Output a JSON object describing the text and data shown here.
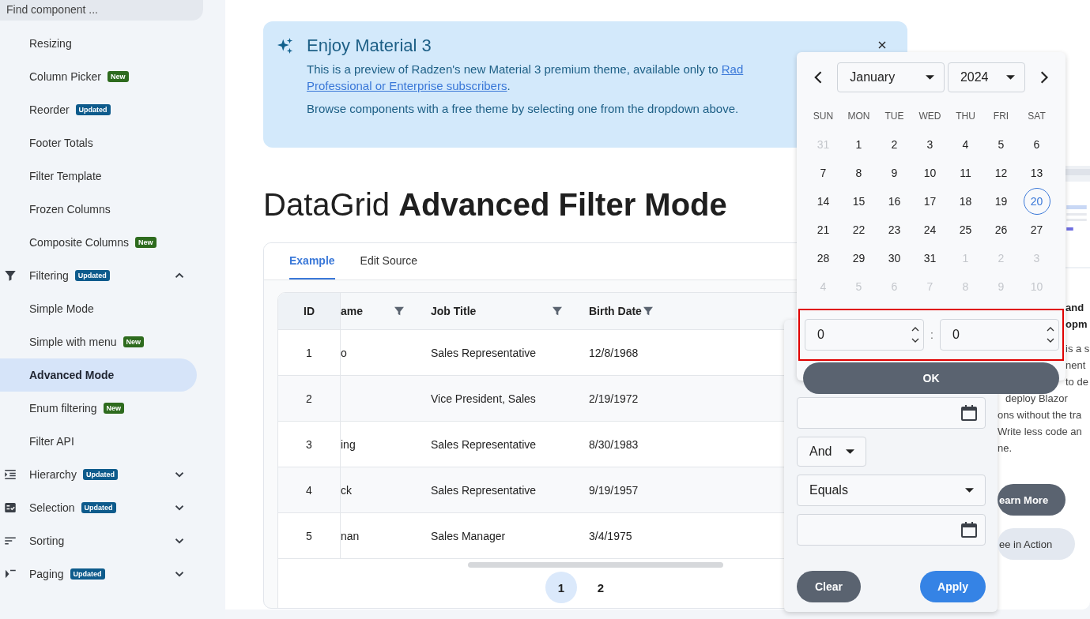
{
  "sidebar": {
    "search": {
      "placeholder": "Find component ..."
    },
    "items": [
      {
        "kind": "sub",
        "label": "Resizing",
        "selected": false
      },
      {
        "kind": "sub",
        "label": "Column Picker",
        "badge": "New",
        "selected": false
      },
      {
        "kind": "sub",
        "label": "Reorder",
        "badge": "Updated",
        "selected": false
      },
      {
        "kind": "sub",
        "label": "Footer Totals",
        "selected": false
      },
      {
        "kind": "sub",
        "label": "Filter Template",
        "selected": false
      },
      {
        "kind": "sub",
        "label": "Frozen Columns",
        "selected": false
      },
      {
        "kind": "sub",
        "label": "Composite Columns",
        "badge": "New",
        "selected": false
      },
      {
        "kind": "group",
        "label": "Filtering",
        "badge": "Updated",
        "expanded": true
      },
      {
        "kind": "sub",
        "label": "Simple Mode",
        "selected": false
      },
      {
        "kind": "sub",
        "label": "Simple with menu",
        "badge": "New",
        "selected": false
      },
      {
        "kind": "sub",
        "label": "Advanced Mode",
        "selected": true
      },
      {
        "kind": "sub",
        "label": "Enum filtering",
        "badge": "New",
        "selected": false
      },
      {
        "kind": "sub",
        "label": "Filter API",
        "selected": false
      },
      {
        "kind": "group",
        "label": "Hierarchy",
        "badge": "Updated",
        "expanded": false
      },
      {
        "kind": "group",
        "label": "Selection",
        "badge": "Updated",
        "expanded": false
      },
      {
        "kind": "group",
        "label": "Sorting",
        "expanded": false
      },
      {
        "kind": "group",
        "label": "Paging",
        "badge": "Updated",
        "expanded": false
      }
    ]
  },
  "banner": {
    "title": "Enjoy Material 3",
    "text": "This is a preview of Radzen's new Material 3 premium theme, available only to ",
    "link_lines": [
      "Rad",
      "Professional or Enterprise subscribers"
    ],
    "text_end": ".",
    "note": "Browse components with a free theme by selecting one from the dropdown above."
  },
  "heading": "DataGrid **Advanced Filter Mode**",
  "tabs": [
    {
      "label": "Example",
      "selected": true
    },
    {
      "label": "Edit Source",
      "selected": false
    }
  ],
  "table": {
    "columns": [
      {
        "label": "ID",
        "filter": false
      },
      {
        "label": "ame",
        "filter": true
      },
      {
        "label": "Job Title",
        "filter": true
      },
      {
        "label": "Birth Date",
        "filter": true
      }
    ],
    "rows": [
      [
        "1",
        "o",
        "Sales Representative",
        "12/8/1968"
      ],
      [
        "2",
        "",
        "Vice President, Sales",
        "2/19/1972"
      ],
      [
        "3",
        "ing",
        "Sales Representative",
        "8/30/1983"
      ],
      [
        "4",
        "ck",
        "Sales Representative",
        "9/19/1957"
      ],
      [
        "5",
        "nan",
        "Sales Manager",
        "3/4/1975"
      ]
    ]
  },
  "pager": [
    {
      "label": "1",
      "selected": true
    },
    {
      "label": "2",
      "selected": false
    }
  ],
  "calendar": {
    "month": "January",
    "year": "2024",
    "weekdays": [
      "SUN",
      "MON",
      "TUE",
      "WED",
      "THU",
      "FRI",
      "SAT"
    ],
    "days": [
      {
        "label": "31",
        "other_month": true,
        "selected": false
      },
      {
        "label": "1",
        "other_month": false,
        "selected": false
      },
      {
        "label": "2",
        "other_month": false,
        "selected": false
      },
      {
        "label": "3",
        "other_month": false,
        "selected": false
      },
      {
        "label": "4",
        "other_month": false,
        "selected": false
      },
      {
        "label": "5",
        "other_month": false,
        "selected": false
      },
      {
        "label": "6",
        "other_month": false,
        "selected": false
      },
      {
        "label": "7",
        "other_month": false,
        "selected": false
      },
      {
        "label": "8",
        "other_month": false,
        "selected": false
      },
      {
        "label": "9",
        "other_month": false,
        "selected": false
      },
      {
        "label": "10",
        "other_month": false,
        "selected": false
      },
      {
        "label": "11",
        "other_month": false,
        "selected": false
      },
      {
        "label": "12",
        "other_month": false,
        "selected": false
      },
      {
        "label": "13",
        "other_month": false,
        "selected": false
      },
      {
        "label": "14",
        "other_month": false,
        "selected": false
      },
      {
        "label": "15",
        "other_month": false,
        "selected": false
      },
      {
        "label": "16",
        "other_month": false,
        "selected": false
      },
      {
        "label": "17",
        "other_month": false,
        "selected": false
      },
      {
        "label": "18",
        "other_month": false,
        "selected": false
      },
      {
        "label": "19",
        "other_month": false,
        "selected": false
      },
      {
        "label": "20",
        "other_month": false,
        "selected": true
      },
      {
        "label": "21",
        "other_month": false,
        "selected": false
      },
      {
        "label": "22",
        "other_month": false,
        "selected": false
      },
      {
        "label": "23",
        "other_month": false,
        "selected": false
      },
      {
        "label": "24",
        "other_month": false,
        "selected": false
      },
      {
        "label": "25",
        "other_month": false,
        "selected": false
      },
      {
        "label": "26",
        "other_month": false,
        "selected": false
      },
      {
        "label": "27",
        "other_month": false,
        "selected": false
      },
      {
        "label": "28",
        "other_month": false,
        "selected": false
      },
      {
        "label": "29",
        "other_month": false,
        "selected": false
      },
      {
        "label": "30",
        "other_month": false,
        "selected": false
      },
      {
        "label": "31",
        "other_month": false,
        "selected": false
      },
      {
        "label": "1",
        "other_month": true,
        "selected": false
      },
      {
        "label": "2",
        "other_month": true,
        "selected": false
      },
      {
        "label": "3",
        "other_month": true,
        "selected": false
      },
      {
        "label": "4",
        "other_month": true,
        "selected": false
      },
      {
        "label": "5",
        "other_month": true,
        "selected": false
      },
      {
        "label": "6",
        "other_month": true,
        "selected": false
      },
      {
        "label": "7",
        "other_month": true,
        "selected": false
      },
      {
        "label": "8",
        "other_month": true,
        "selected": false
      },
      {
        "label": "9",
        "other_month": true,
        "selected": false
      },
      {
        "label": "10",
        "other_month": true,
        "selected": false
      }
    ],
    "hour": "0",
    "separator": ":",
    "minute": "0",
    "ok": "OK"
  },
  "filter_popup": {
    "logic": "And",
    "operator": "Equals",
    "clear": "Clear",
    "apply": "Apply"
  },
  "aside": {
    "title_lines": [
      "and",
      "opm"
    ],
    "lines": [
      "is a s",
      "nent",
      "to de",
      "deploy Blazor",
      "ons without the tra",
      "Write less code an",
      "ne."
    ],
    "primary": "earn More",
    "secondary": "ee in Action"
  }
}
